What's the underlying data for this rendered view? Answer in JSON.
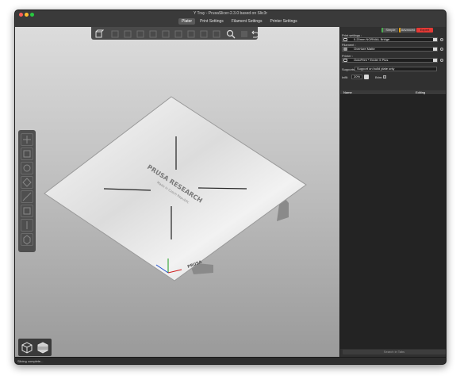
{
  "window": {
    "title": "Y Tray - PrusaSlicer-2.3.0 based on Slic3r",
    "tabs": [
      {
        "label": "Plater",
        "active": true
      },
      {
        "label": "Print Settings",
        "active": false
      },
      {
        "label": "Filament Settings",
        "active": false
      },
      {
        "label": "Printer Settings",
        "active": false
      }
    ]
  },
  "toolbar": {
    "icons": [
      "add-icon",
      "delete-icon",
      "delete-all-icon",
      "arrange-icon",
      "copy-icon",
      "paste-icon",
      "add-instance-icon",
      "remove-instance-icon",
      "split-icon",
      "layers-icon",
      "search-icon",
      "layer-edit-icon",
      "undo-icon"
    ]
  },
  "left_tools": {
    "icons": [
      "move-icon",
      "scale-icon",
      "rotate-icon",
      "place-on-face-icon",
      "cut-icon",
      "paint-supports-icon",
      "seam-icon",
      "hollow-icon"
    ]
  },
  "view_toggle": {
    "icons": [
      "3d-view-icon",
      "preview-icon"
    ]
  },
  "bed": {
    "brand_text": "PRUSA RESEARCH",
    "sub_text": "Made in Czech Republic",
    "corner_logo": "PRUSA"
  },
  "panel": {
    "mode_buttons": [
      {
        "label": "Simple",
        "selected": false,
        "color": "#4caf50"
      },
      {
        "label": "Advanced",
        "selected": false,
        "color": "#e8a317"
      },
      {
        "label": "Expert",
        "selected": true,
        "color": "#e53935"
      }
    ],
    "print_settings": {
      "label": "Print settings :",
      "value": "0.20mm NORMAL Bridge",
      "icon": "print-settings-icon"
    },
    "filament": {
      "label": "Filament :",
      "value": "Overture Matte",
      "color": "#9a9a9a"
    },
    "printer": {
      "label": "Printer :",
      "value": "OctoPrint * Ender 5 Plus",
      "icon": "printer-icon"
    },
    "supports": {
      "label": "Supports:",
      "value": "Support on build plate only"
    },
    "infill": {
      "label": "Infill:",
      "value": "20%"
    },
    "brim": {
      "label": "Brim:"
    },
    "object_list": {
      "columns": [
        "Name",
        "Editing"
      ],
      "rows": []
    },
    "search_placeholder": "Search in Tabs"
  },
  "status": {
    "text": "Slicing complete..."
  }
}
